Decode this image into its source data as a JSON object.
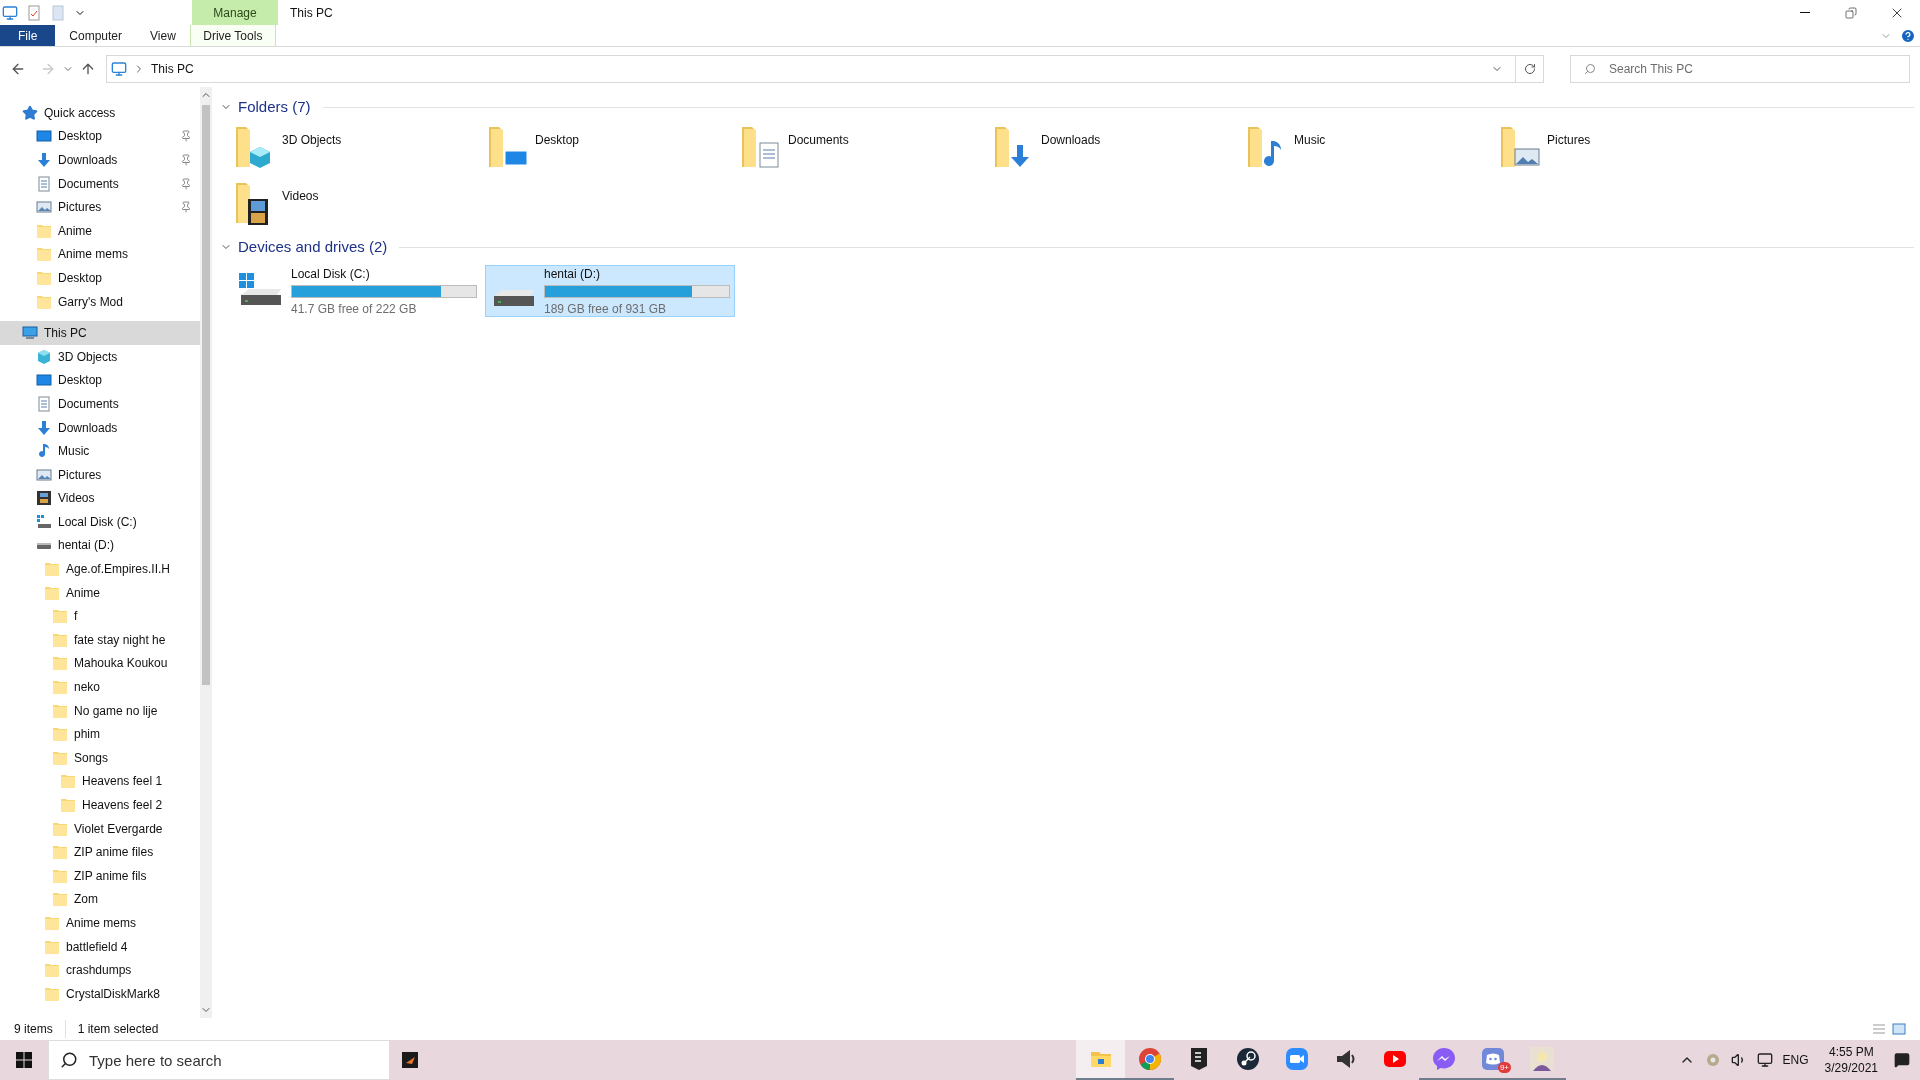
{
  "window": {
    "title": "This PC"
  },
  "ribbon": {
    "contextual_group": "Manage",
    "tabs": [
      {
        "label": "File",
        "kind": "file",
        "selected": false
      },
      {
        "label": "Computer",
        "kind": "tab",
        "selected": false
      },
      {
        "label": "View",
        "kind": "tab",
        "selected": false
      },
      {
        "label": "Drive Tools",
        "kind": "contextual",
        "selected": false
      }
    ]
  },
  "navigation_buttons": {
    "back": {
      "disabled": false
    },
    "forward": {
      "disabled": true
    }
  },
  "address_bar": {
    "path": "This PC"
  },
  "search": {
    "placeholder": "Search This PC"
  },
  "navigation": [
    {
      "label": "Quick access",
      "kind": "star",
      "selected": false,
      "children": [
        {
          "label": "Desktop",
          "kind": "desktop",
          "pinned": true,
          "selected": false
        },
        {
          "label": "Downloads",
          "kind": "downloads",
          "pinned": true,
          "selected": false
        },
        {
          "label": "Documents",
          "kind": "documents",
          "pinned": true,
          "selected": false
        },
        {
          "label": "Pictures",
          "kind": "pictures",
          "pinned": true,
          "selected": false
        },
        {
          "label": "Anime",
          "kind": "folder",
          "pinned": false,
          "selected": false
        },
        {
          "label": "Anime mems",
          "kind": "folder",
          "pinned": false,
          "selected": false
        },
        {
          "label": "Desktop",
          "kind": "folder",
          "pinned": false,
          "selected": false
        },
        {
          "label": "Garry's Mod",
          "kind": "folder",
          "pinned": false,
          "selected": false
        }
      ]
    },
    {
      "label": "This PC",
      "kind": "pc",
      "selected": true,
      "children": [
        {
          "label": "3D Objects",
          "kind": "objects",
          "selected": false
        },
        {
          "label": "Desktop",
          "kind": "desktop",
          "selected": false
        },
        {
          "label": "Documents",
          "kind": "documents",
          "selected": false
        },
        {
          "label": "Downloads",
          "kind": "downloads",
          "selected": false
        },
        {
          "label": "Music",
          "kind": "music",
          "selected": false
        },
        {
          "label": "Pictures",
          "kind": "pictures",
          "selected": false
        },
        {
          "label": "Videos",
          "kind": "videos",
          "selected": false
        },
        {
          "label": "Local Disk (C:)",
          "kind": "system_drive",
          "selected": false
        },
        {
          "label": "hentai (D:)",
          "kind": "drive",
          "selected": false,
          "children": [
            {
              "label": "Age.of.Empires.II.H",
              "kind": "folder",
              "selected": false
            },
            {
              "label": "Anime",
              "kind": "folder",
              "selected": false,
              "children": [
                {
                  "label": "f",
                  "kind": "folder",
                  "selected": false
                },
                {
                  "label": "fate stay night he",
                  "kind": "folder",
                  "selected": false
                },
                {
                  "label": "Mahouka Koukou",
                  "kind": "folder",
                  "selected": false
                },
                {
                  "label": "neko",
                  "kind": "folder",
                  "selected": false
                },
                {
                  "label": "No game no lije",
                  "kind": "folder",
                  "selected": false
                },
                {
                  "label": "phim",
                  "kind": "folder",
                  "selected": false
                },
                {
                  "label": "Songs",
                  "kind": "folder",
                  "selected": false,
                  "children": [
                    {
                      "label": "Heavens feel 1",
                      "kind": "folder",
                      "selected": false
                    },
                    {
                      "label": "Heavens feel 2",
                      "kind": "folder",
                      "selected": false
                    }
                  ]
                },
                {
                  "label": "Violet Evergarde",
                  "kind": "folder",
                  "selected": false
                },
                {
                  "label": "ZIP anime files",
                  "kind": "folder",
                  "selected": false
                },
                {
                  "label": "ZIP anime fils",
                  "kind": "folder",
                  "selected": false
                },
                {
                  "label": "Zom",
                  "kind": "folder",
                  "selected": false
                }
              ]
            },
            {
              "label": "Anime mems",
              "kind": "folder",
              "selected": false
            },
            {
              "label": "battlefield 4",
              "kind": "folder",
              "selected": false
            },
            {
              "label": "crashdumps",
              "kind": "folder",
              "selected": false
            },
            {
              "label": "CrystalDiskMark8",
              "kind": "folder",
              "selected": false
            }
          ]
        }
      ]
    }
  ],
  "groups": [
    {
      "title": "Folders (7)",
      "kind": "folders",
      "items": [
        {
          "label": "3D Objects",
          "kind": "objects"
        },
        {
          "label": "Desktop",
          "kind": "desktop"
        },
        {
          "label": "Documents",
          "kind": "documents"
        },
        {
          "label": "Downloads",
          "kind": "downloads"
        },
        {
          "label": "Music",
          "kind": "music"
        },
        {
          "label": "Pictures",
          "kind": "pictures"
        },
        {
          "label": "Videos",
          "kind": "videos"
        }
      ]
    },
    {
      "title": "Devices and drives (2)",
      "kind": "drives",
      "items": [
        {
          "label": "Local Disk (C:)",
          "kind": "system_drive",
          "level": 0.81,
          "free": "41.7 GB free of 222 GB",
          "selected": false
        },
        {
          "label": "hentai (D:)",
          "kind": "drive",
          "level": 0.8,
          "free": "189 GB free of 931 GB",
          "selected": true
        }
      ]
    }
  ],
  "status_bar": {
    "item_count": "9 items",
    "selection": "1 item selected"
  },
  "taskbar": {
    "search_placeholder": "Type here to search",
    "pinned_left": [
      {
        "kind": "dark_app"
      }
    ],
    "apps": [
      {
        "kind": "explorer",
        "active": true,
        "open": true
      },
      {
        "kind": "chrome",
        "active": false,
        "open": true
      },
      {
        "kind": "epic",
        "active": false,
        "open": false
      },
      {
        "kind": "steam",
        "active": false,
        "open": false
      },
      {
        "kind": "zoom",
        "active": false,
        "open": false
      },
      {
        "kind": "speaker",
        "active": false,
        "open": false
      },
      {
        "kind": "youtube",
        "active": false,
        "open": false
      },
      {
        "kind": "messenger",
        "active": false,
        "open": true
      },
      {
        "kind": "discord",
        "active": false,
        "open": true,
        "badge": "9+"
      },
      {
        "kind": "avatar",
        "active": false,
        "open": true
      }
    ],
    "tray": {
      "language": "ENG",
      "time": "4:55 PM",
      "date": "3/29/2021"
    }
  }
}
